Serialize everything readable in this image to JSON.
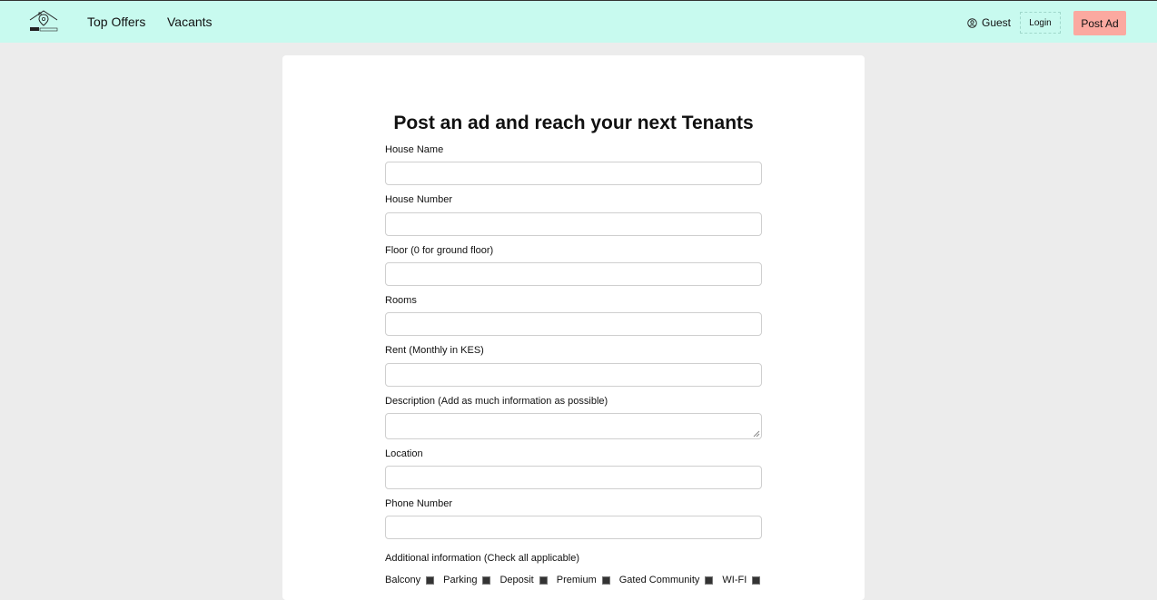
{
  "nav": {
    "links": [
      "Top Offers",
      "Vacants"
    ],
    "user_label": "Guest",
    "login_label": "Login",
    "post_label": "Post Ad",
    "accent_color": "#c8faef",
    "post_color": "#fba9a0"
  },
  "form": {
    "title": "Post an ad and reach your next Tenants",
    "fields": [
      "House Name",
      "House Number",
      "Floor (0 for ground floor)",
      "Rooms",
      "Rent (Monthly in KES)",
      "Description (Add as much information as possible)",
      "Location",
      "Phone Number"
    ],
    "additional_label": "Additional information (Check all applicable)",
    "options": [
      "Balcony",
      "Parking",
      "Deposit",
      "Premium",
      "Gated Community",
      "WI-FI"
    ]
  }
}
